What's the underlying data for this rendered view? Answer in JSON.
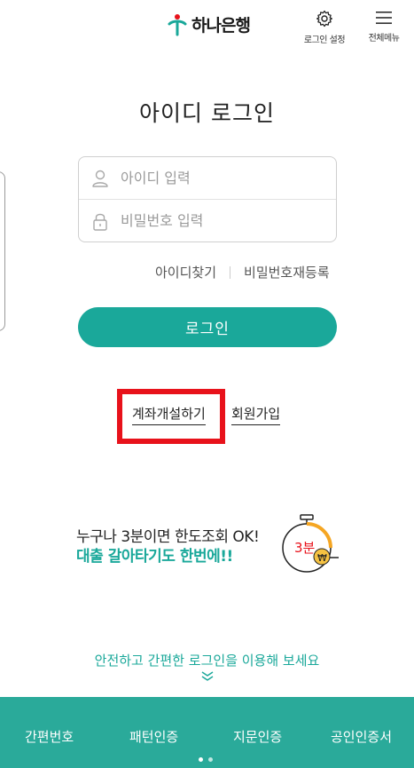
{
  "header": {
    "brand": "하나은행",
    "login_settings_label": "로그인 설정",
    "menu_label": "전체메뉴"
  },
  "main": {
    "title": "아이디 로그인",
    "id_placeholder": "아이디 입력",
    "pw_placeholder": "비밀번호 입력",
    "find_id": "아이디찾기",
    "reset_password": "비밀번호재등록",
    "login_button": "로그인",
    "open_account": "계좌개설하기",
    "sign_up": "회원가입"
  },
  "banner": {
    "line1": "누구나 3분이면 한도조회 OK!",
    "line2": "대출 갈아타기도 한번에!!",
    "badge": "3분",
    "coin": "₩"
  },
  "guide": {
    "text": "안전하고 간편한 로그인을 이용해 보세요"
  },
  "bottom_tabs": [
    "간편번호",
    "패턴인증",
    "지문인증",
    "공인인증서"
  ],
  "colors": {
    "accent": "#1aa89a",
    "bottom_bar": "#2aaa9a",
    "highlight_box": "#e8121b"
  }
}
